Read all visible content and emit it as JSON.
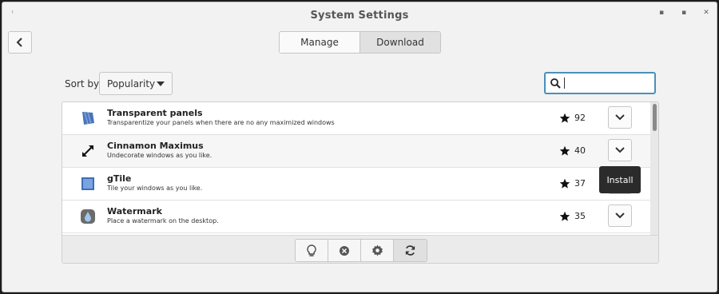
{
  "window": {
    "title": "System Settings",
    "app_icon": "ᵎ",
    "minimize": "▪",
    "maximize": "▪",
    "close": "✕"
  },
  "header": {
    "tabs": [
      {
        "label": "Manage",
        "active": true
      },
      {
        "label": "Download",
        "active": false
      }
    ]
  },
  "filters": {
    "sort_label": "Sort by",
    "sort_value": "Popularity",
    "search_value": "",
    "search_placeholder": ""
  },
  "applets": [
    {
      "name": "Transparent panels",
      "description": "Transparentize your panels when there are no any maximized windows",
      "score": "92",
      "icon": "transparent-panels-icon"
    },
    {
      "name": "Cinnamon Maximus",
      "description": "Undecorate windows as you like.",
      "score": "40",
      "icon": "expand-arrows-icon"
    },
    {
      "name": "gTile",
      "description": "Tile your windows as you like.",
      "score": "37",
      "icon": "gtile-icon"
    },
    {
      "name": "Watermark",
      "description": "Place a watermark on the desktop.",
      "score": "35",
      "icon": "watermark-icon"
    }
  ],
  "tooltip": {
    "text": "Install"
  },
  "toolbar": {
    "items": [
      "lightbulb-icon",
      "remove-icon",
      "gear-icon",
      "refresh-icon"
    ]
  },
  "colors": {
    "accent": "#4a90b9",
    "window_bg": "#f2f2f2",
    "tooltip_bg": "#2b2b2b"
  }
}
